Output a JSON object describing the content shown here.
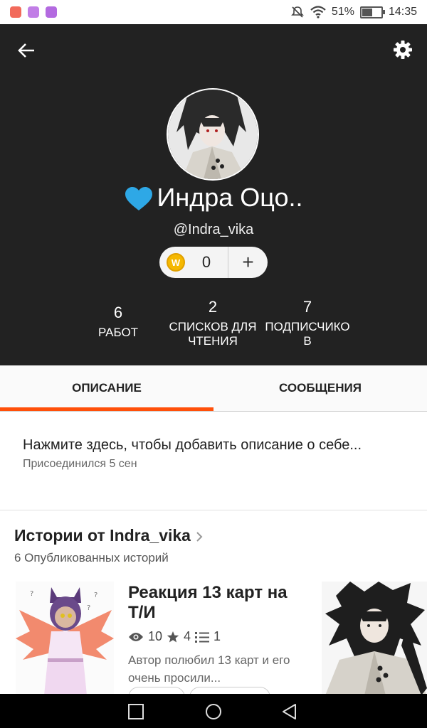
{
  "status_bar": {
    "battery": "51%",
    "battery_level": 0.51,
    "time": "14:35",
    "app_icons": [
      "mail-icon",
      "gallery-icon",
      "messenger-icon"
    ],
    "app_icon_colors": [
      "#f26a5b",
      "#c17ee6",
      "#b36ae0"
    ]
  },
  "profile": {
    "display_name": "Индра Оцо..",
    "username": "@Indra_vika",
    "coins": "0",
    "coin_add": "+",
    "coin_icon_letter": "W",
    "stats": [
      {
        "value": "6",
        "label": "РАБОТ"
      },
      {
        "value": "2",
        "label": "СПИСКОВ ДЛЯ ЧТЕНИЯ"
      },
      {
        "value": "7",
        "label": "ПОДПИСЧИКО В"
      }
    ]
  },
  "tabs": [
    {
      "label": "ОПИСАНИЕ",
      "active": true
    },
    {
      "label": "СООБЩЕНИЯ",
      "active": false
    }
  ],
  "description": {
    "prompt": "Нажмите здесь, чтобы добавить описание о себе...",
    "joined": "Присоединился 5 сен"
  },
  "stories": {
    "title": "Истории от Indra_vika",
    "subtitle": "6 Опубликованных историй",
    "items": [
      {
        "title": "Реакция 13 карт на Т/И",
        "views": "10",
        "votes": "4",
        "parts": "1",
        "excerpt": "Автор полюбил 13 карт и его очень просили..."
      }
    ]
  },
  "colors": {
    "header_bg": "#222222",
    "accent": "#ff500a",
    "heart": "#2ea8e6"
  }
}
